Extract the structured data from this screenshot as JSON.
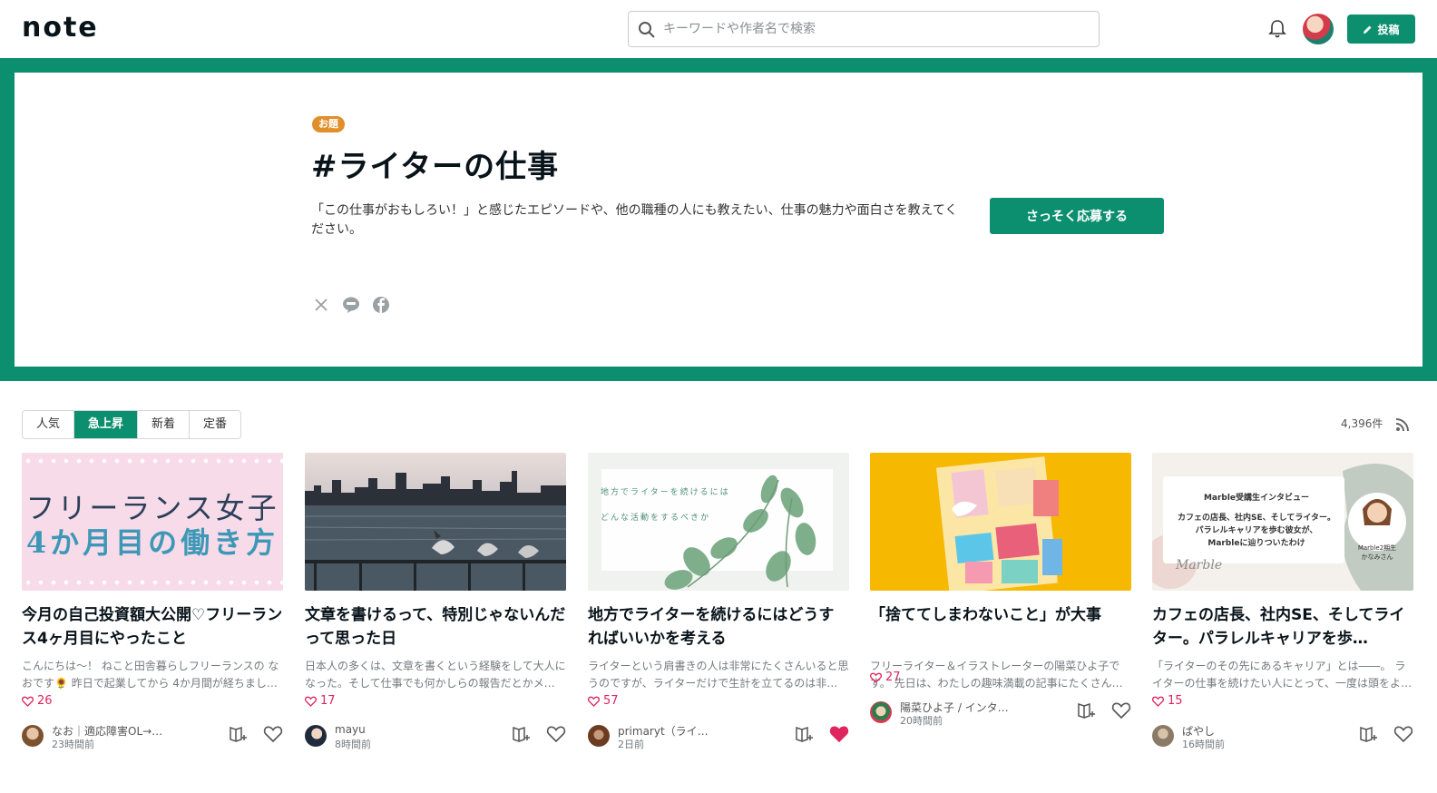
{
  "header": {
    "logo": "note",
    "search_placeholder": "キーワードや作者名で検索",
    "post_label": "投稿"
  },
  "hero": {
    "badge": "お題",
    "title": "#ライターの仕事",
    "description": "「この仕事がおもしろい！」と感じたエピソードや、他の職種の人にも教えたい、仕事の魅力や面白さを教えてください。",
    "apply_label": "さっそく応募する",
    "share_icons": [
      "x-icon",
      "line-icon",
      "facebook-icon"
    ]
  },
  "tabs": [
    {
      "label": "人気",
      "active": false
    },
    {
      "label": "急上昇",
      "active": true
    },
    {
      "label": "新着",
      "active": false
    },
    {
      "label": "定番",
      "active": false
    }
  ],
  "count": "4,396件",
  "cards": [
    {
      "thumb_text_1": "フリーランス女子",
      "thumb_text_2": "4か月目の働き方",
      "title": "今月の自己投資額大公開♡フリーランス4ヶ月目にやったこと",
      "excerpt": "こんにちは～！ ねこと田舎暮らしフリーランスの なおです🌻 昨日で起業してから 4か月間が経ちまし…",
      "likes": "26",
      "author": "なお｜適応障害OL→…",
      "time": "23時間前",
      "liked": false
    },
    {
      "title": "文章を書けるって、特別じゃないんだって思った日",
      "excerpt": "日本人の多くは、文章を書くという経験をして大人になった。そして仕事でも何かしらの報告だとかメ…",
      "likes": "17",
      "author": "mayu",
      "time": "8時間前",
      "liked": false
    },
    {
      "thumb_text_1": "地方でライターを続けるには",
      "thumb_text_2": "どんな活動をするべきか",
      "title": "地方でライターを続けるにはどうすればいいかを考える",
      "excerpt": "ライターという肩書きの人は非常にたくさんいると思うのですが、ライターだけで生計を立てるのは非…",
      "likes": "57",
      "author": "primaryt（ライ…",
      "time": "2日前",
      "liked": true
    },
    {
      "title": "「捨ててしまわないこと」が大事",
      "excerpt": "フリーライター＆イラストレーターの陽菜ひよ子です。 先日は、わたしの趣味満載の記事にたくさん…",
      "likes": "27",
      "author": "陽菜ひよ子 / インタ…",
      "time": "20時間前",
      "liked": false
    },
    {
      "thumb_text_1": "Marble受講生インタビュー",
      "thumb_text_2": "カフェの店長、社内SE、そしてライター。",
      "thumb_text_3": "パラレルキャリアを歩む彼女が、",
      "thumb_text_4": "Marbleに辿りついたわけ",
      "thumb_logo": "Marble",
      "thumb_caption_1": "Marble2期生",
      "thumb_caption_2": "かなみさん",
      "title": "カフェの店長、社内SE、そしてライター。パラレルキャリアを歩…",
      "excerpt": "「ライターのその先にあるキャリア」とは――。 ライターの仕事を続けたい人にとって、一度は頭をよ…",
      "likes": "15",
      "author": "ぱやし",
      "time": "16時間前",
      "liked": false
    }
  ],
  "colors": {
    "brand": "#0c8f6f",
    "badge": "#e08f2a",
    "like": "#e0245e"
  }
}
